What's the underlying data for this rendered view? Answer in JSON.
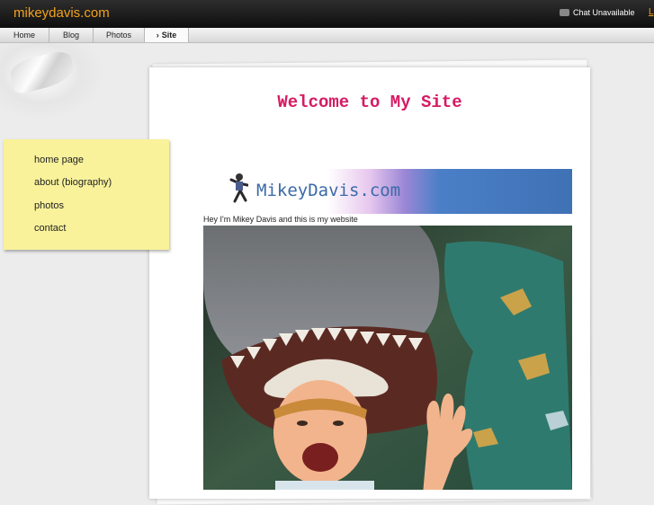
{
  "header": {
    "brand": "mikeydavis.com",
    "chat_status": "Chat Unavailable",
    "login_link": "L"
  },
  "nav": {
    "tabs": [
      {
        "label": "Home"
      },
      {
        "label": "Blog"
      },
      {
        "label": "Photos"
      },
      {
        "label": "Site",
        "active": true
      }
    ]
  },
  "main": {
    "title": "Welcome to My Site",
    "banner_text": "MikeyDavis.com",
    "intro": "Hey I'm Mikey Davis and this is my website"
  },
  "sidebar": {
    "items": [
      {
        "label": "home page"
      },
      {
        "label": "about (biography)"
      },
      {
        "label": "photos"
      },
      {
        "label": "contact"
      }
    ]
  },
  "colors": {
    "brand": "#f3a21c",
    "title": "#d61a63",
    "sticky_note": "#f9f29b",
    "header_bg": "#111111"
  }
}
